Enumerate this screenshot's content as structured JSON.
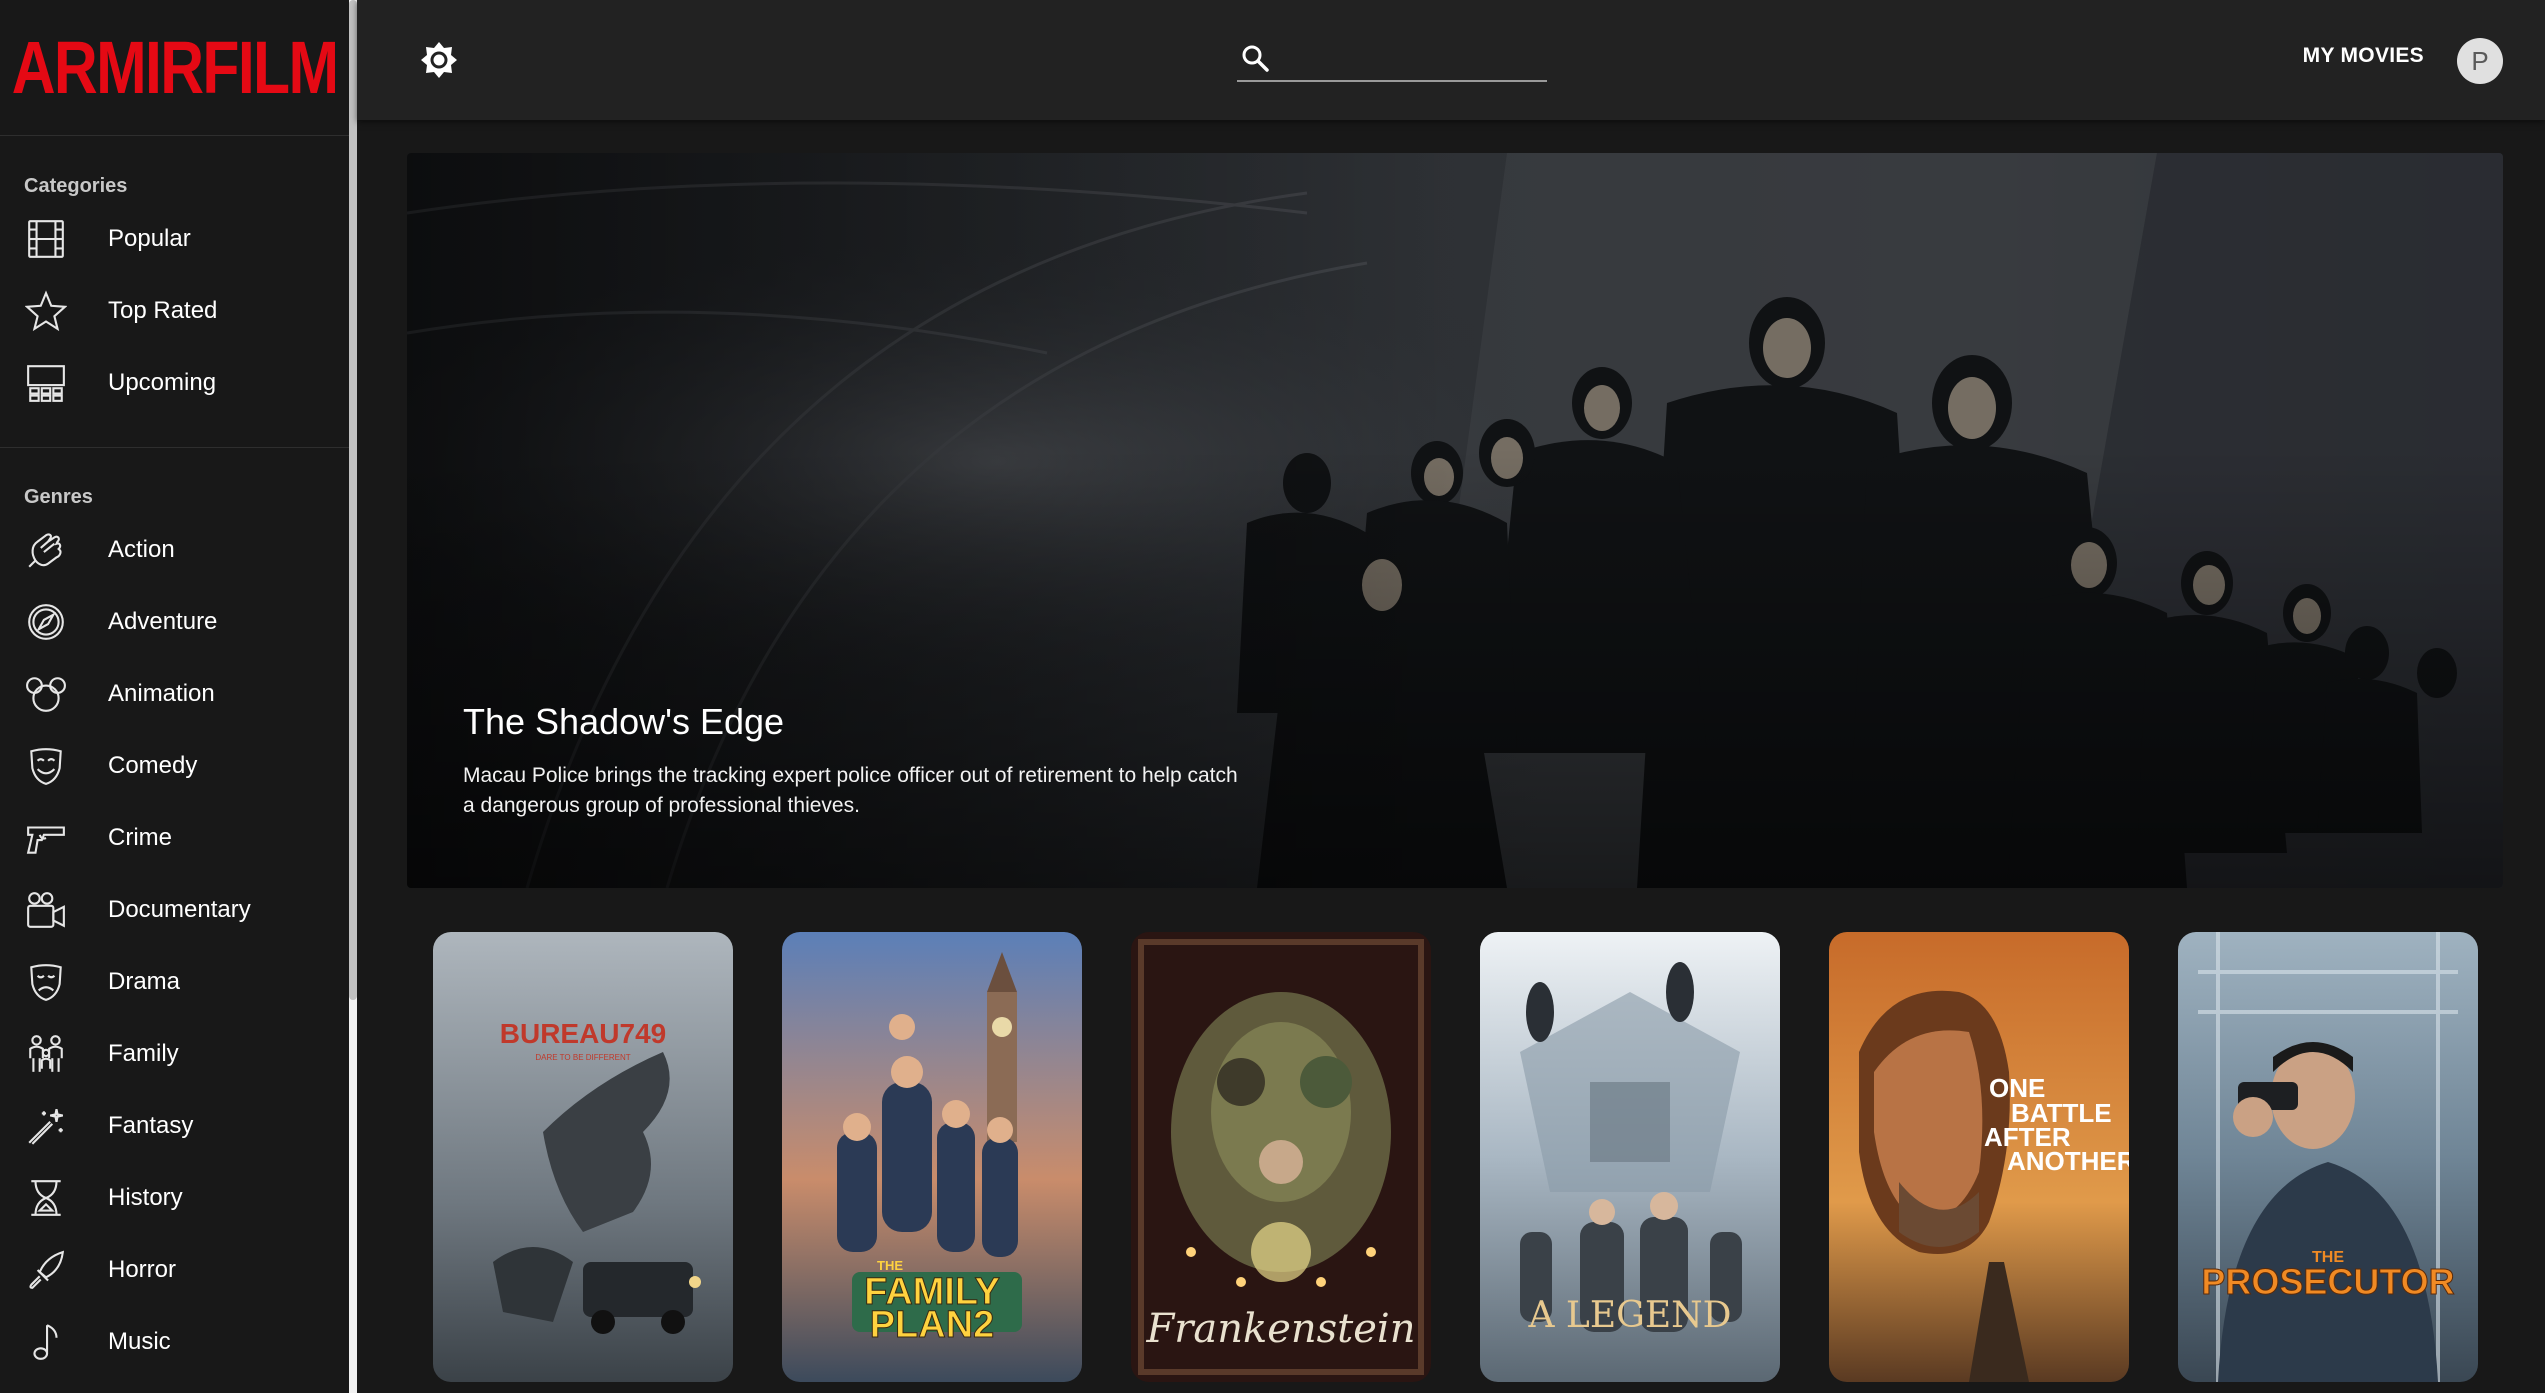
{
  "app": {
    "logo": "ARMIRFILM"
  },
  "sidebar": {
    "categories_title": "Categories",
    "categories": [
      {
        "label": "Popular",
        "icon": "film-icon"
      },
      {
        "label": "Top Rated",
        "icon": "star-icon"
      },
      {
        "label": "Upcoming",
        "icon": "theater-seats-icon"
      }
    ],
    "genres_title": "Genres",
    "genres": [
      {
        "label": "Action",
        "icon": "fist-icon"
      },
      {
        "label": "Adventure",
        "icon": "compass-icon"
      },
      {
        "label": "Animation",
        "icon": "mouse-ears-icon"
      },
      {
        "label": "Comedy",
        "icon": "mask-smile-icon"
      },
      {
        "label": "Crime",
        "icon": "pistol-icon"
      },
      {
        "label": "Documentary",
        "icon": "movie-camera-icon"
      },
      {
        "label": "Drama",
        "icon": "mask-sad-icon"
      },
      {
        "label": "Family",
        "icon": "family-icon"
      },
      {
        "label": "Fantasy",
        "icon": "magic-wand-icon"
      },
      {
        "label": "History",
        "icon": "hourglass-icon"
      },
      {
        "label": "Horror",
        "icon": "knife-icon"
      },
      {
        "label": "Music",
        "icon": "music-note-icon"
      }
    ]
  },
  "topbar": {
    "theme_icon": "brightness-icon",
    "search_icon": "search-icon",
    "search_value": "",
    "my_movies_label": "MY MOVIES",
    "avatar_letter": "P"
  },
  "hero": {
    "title": "The Shadow's Edge",
    "overview": "Macau Police brings the tracking expert police officer out of retirement to help catch a dangerous group of professional thieves."
  },
  "posters": [
    {
      "title_art": "BUREAU749",
      "tagline_art": "DARE TO BE DIFFERENT"
    },
    {
      "title_art_line1": "THE",
      "title_art_line2": "FAMILY",
      "title_art_line3": "PLAN2"
    },
    {
      "title_art": "Frankenstein"
    },
    {
      "title_art": "A LEGEND"
    },
    {
      "title_art_line1": "ONE",
      "title_art_line2": "BATTLE",
      "title_art_line3": "AFTER",
      "title_art_line4": "ANOTHER"
    },
    {
      "title_art_line1": "THE",
      "title_art_line2": "PROSECUTOR"
    }
  ],
  "colors": {
    "brand": "#e50914",
    "background": "#181818",
    "topbar": "#222222"
  }
}
